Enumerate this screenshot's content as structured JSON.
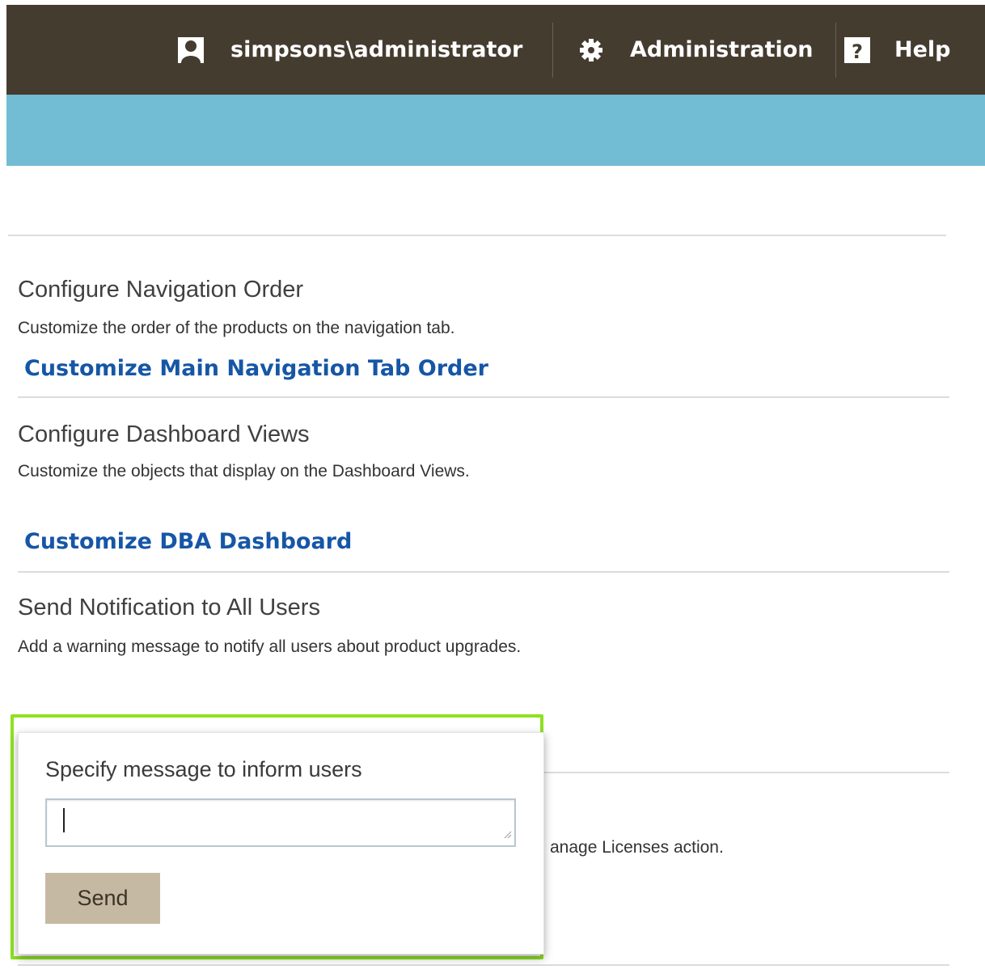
{
  "header": {
    "user_label": "simpsons\\administrator",
    "admin_label": "Administration",
    "help_label": "Help",
    "background_color": "#453c30",
    "icons": {
      "user": "user-icon",
      "admin": "gear-icon",
      "help": "help-icon"
    }
  },
  "banner": {
    "color": "#72bcd4"
  },
  "sections": {
    "navigation": {
      "title": "Configure Navigation Order",
      "description": "Customize the order of the products on the navigation tab.",
      "link": "Customize Main Navigation Tab Order"
    },
    "dashboard": {
      "title": "Configure Dashboard Views",
      "description": "Customize the objects that display on the Dashboard Views.",
      "link": "Customize DBA Dashboard"
    },
    "notification": {
      "title": "Send Notification to All Users",
      "description": "Add a warning message to notify all users about product upgrades."
    },
    "licenses_partial": "anage Licenses action."
  },
  "notification_popup": {
    "label": "Specify message to inform users",
    "input_value": "",
    "send_label": "Send",
    "highlight_color": "#8de21f",
    "button_color": "#c6b9a3"
  },
  "colors": {
    "link": "#1656a6",
    "text": "#404040"
  }
}
